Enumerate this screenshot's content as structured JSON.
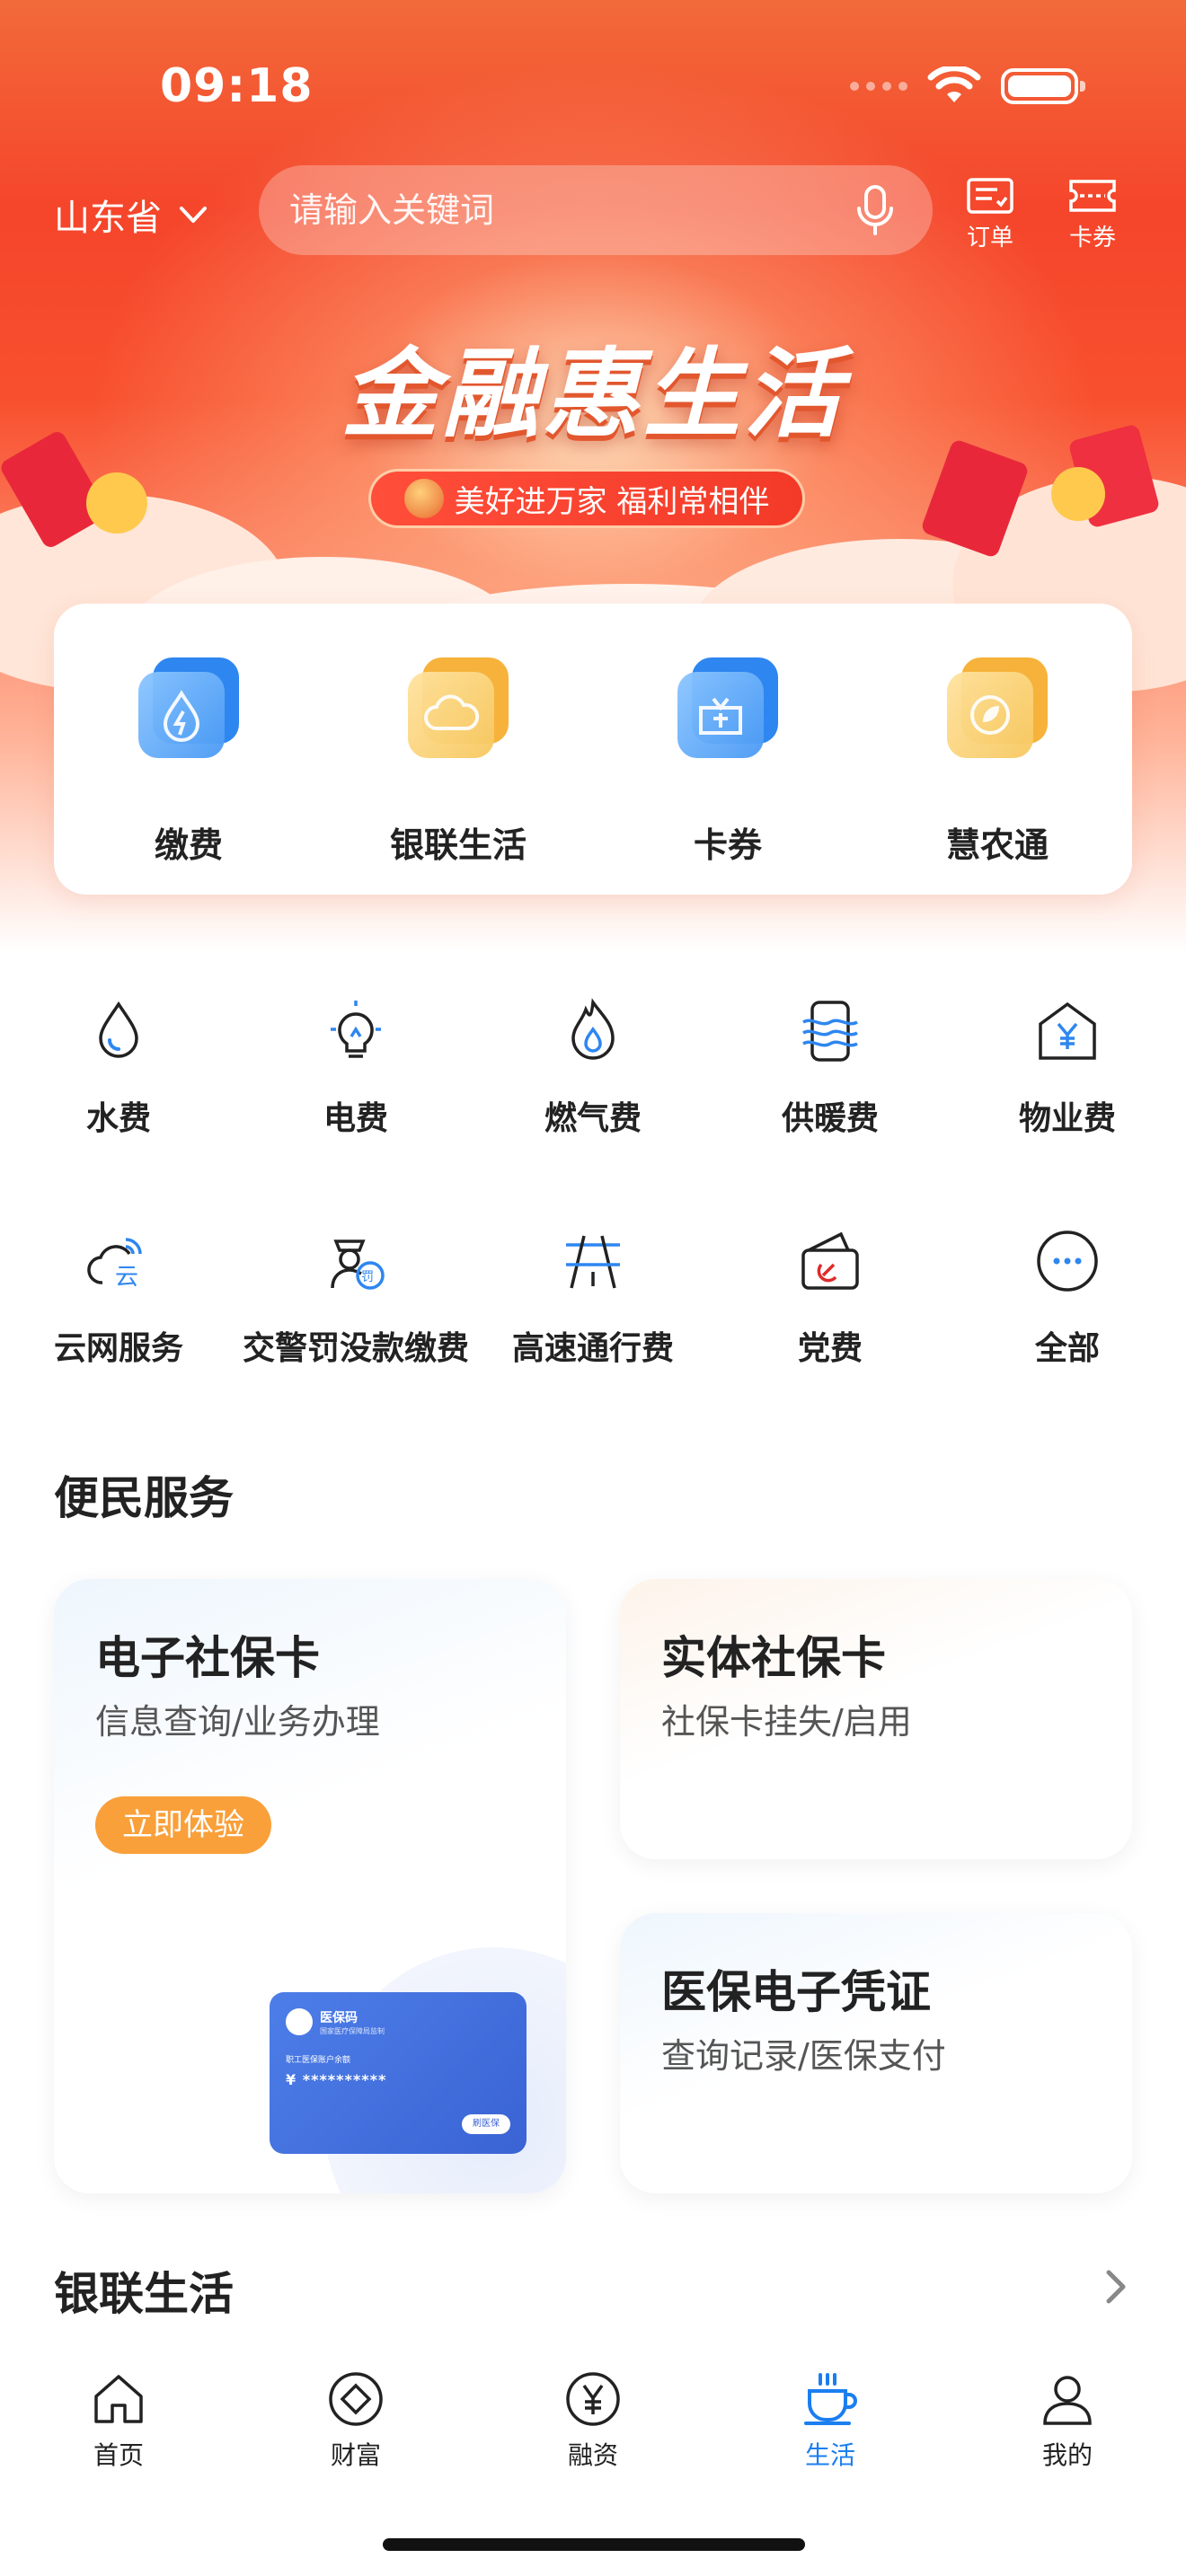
{
  "status_bar": {
    "time": "09:18"
  },
  "header": {
    "region": "山东省",
    "search_placeholder": "请输入关键词",
    "orders_label": "订单",
    "coupons_label": "卡券"
  },
  "banner": {
    "title": "金融惠生活",
    "slogan": "美好进万家 福利常相伴"
  },
  "quick_services": [
    {
      "label": "缴费",
      "icon": "water-bolt-icon"
    },
    {
      "label": "银联生活",
      "icon": "cloud-icon"
    },
    {
      "label": "卡券",
      "icon": "ticket-icon"
    },
    {
      "label": "慧农通",
      "icon": "leaf-icon"
    }
  ],
  "payment_grid": {
    "row1": [
      {
        "label": "水费",
        "icon": "water-drop-icon"
      },
      {
        "label": "电费",
        "icon": "lightbulb-icon"
      },
      {
        "label": "燃气费",
        "icon": "flame-icon"
      },
      {
        "label": "供暖费",
        "icon": "heating-icon"
      },
      {
        "label": "物业费",
        "icon": "house-yen-icon"
      }
    ],
    "row2": [
      {
        "label": "云网服务",
        "icon": "cloud-network-icon"
      },
      {
        "label": "交警罚没款缴费",
        "icon": "traffic-police-icon"
      },
      {
        "label": "高速通行费",
        "icon": "highway-icon"
      },
      {
        "label": "党费",
        "icon": "party-fee-icon"
      },
      {
        "label": "全部",
        "icon": "more-dots-icon"
      }
    ]
  },
  "convenience": {
    "title": "便民服务",
    "e_social_card": {
      "title": "电子社保卡",
      "subtitle": "信息查询/业务办理",
      "button": "立即体验",
      "mini_card": {
        "title": "医保码",
        "subtitle": "国家医疗保障局监制",
        "line": "职工医保账户余额",
        "amount": "¥ **********",
        "button": "刷医保"
      }
    },
    "physical_card": {
      "title": "实体社保卡",
      "subtitle": "社保卡挂失/启用"
    },
    "medical_voucher": {
      "title": "医保电子凭证",
      "subtitle": "查询记录/医保支付"
    }
  },
  "unionpay_life": {
    "title": "银联生活"
  },
  "tabbar": [
    {
      "label": "首页",
      "icon": "home-icon",
      "active": false
    },
    {
      "label": "财富",
      "icon": "wealth-diamond-icon",
      "active": false
    },
    {
      "label": "融资",
      "icon": "yen-circle-icon",
      "active": false
    },
    {
      "label": "生活",
      "icon": "coffee-cup-icon",
      "active": true
    },
    {
      "label": "我的",
      "icon": "user-icon",
      "active": false
    }
  ],
  "colors": {
    "brand_red": "#f5452b",
    "active_blue": "#1b7ef0",
    "button_orange": "#f9a03a"
  }
}
